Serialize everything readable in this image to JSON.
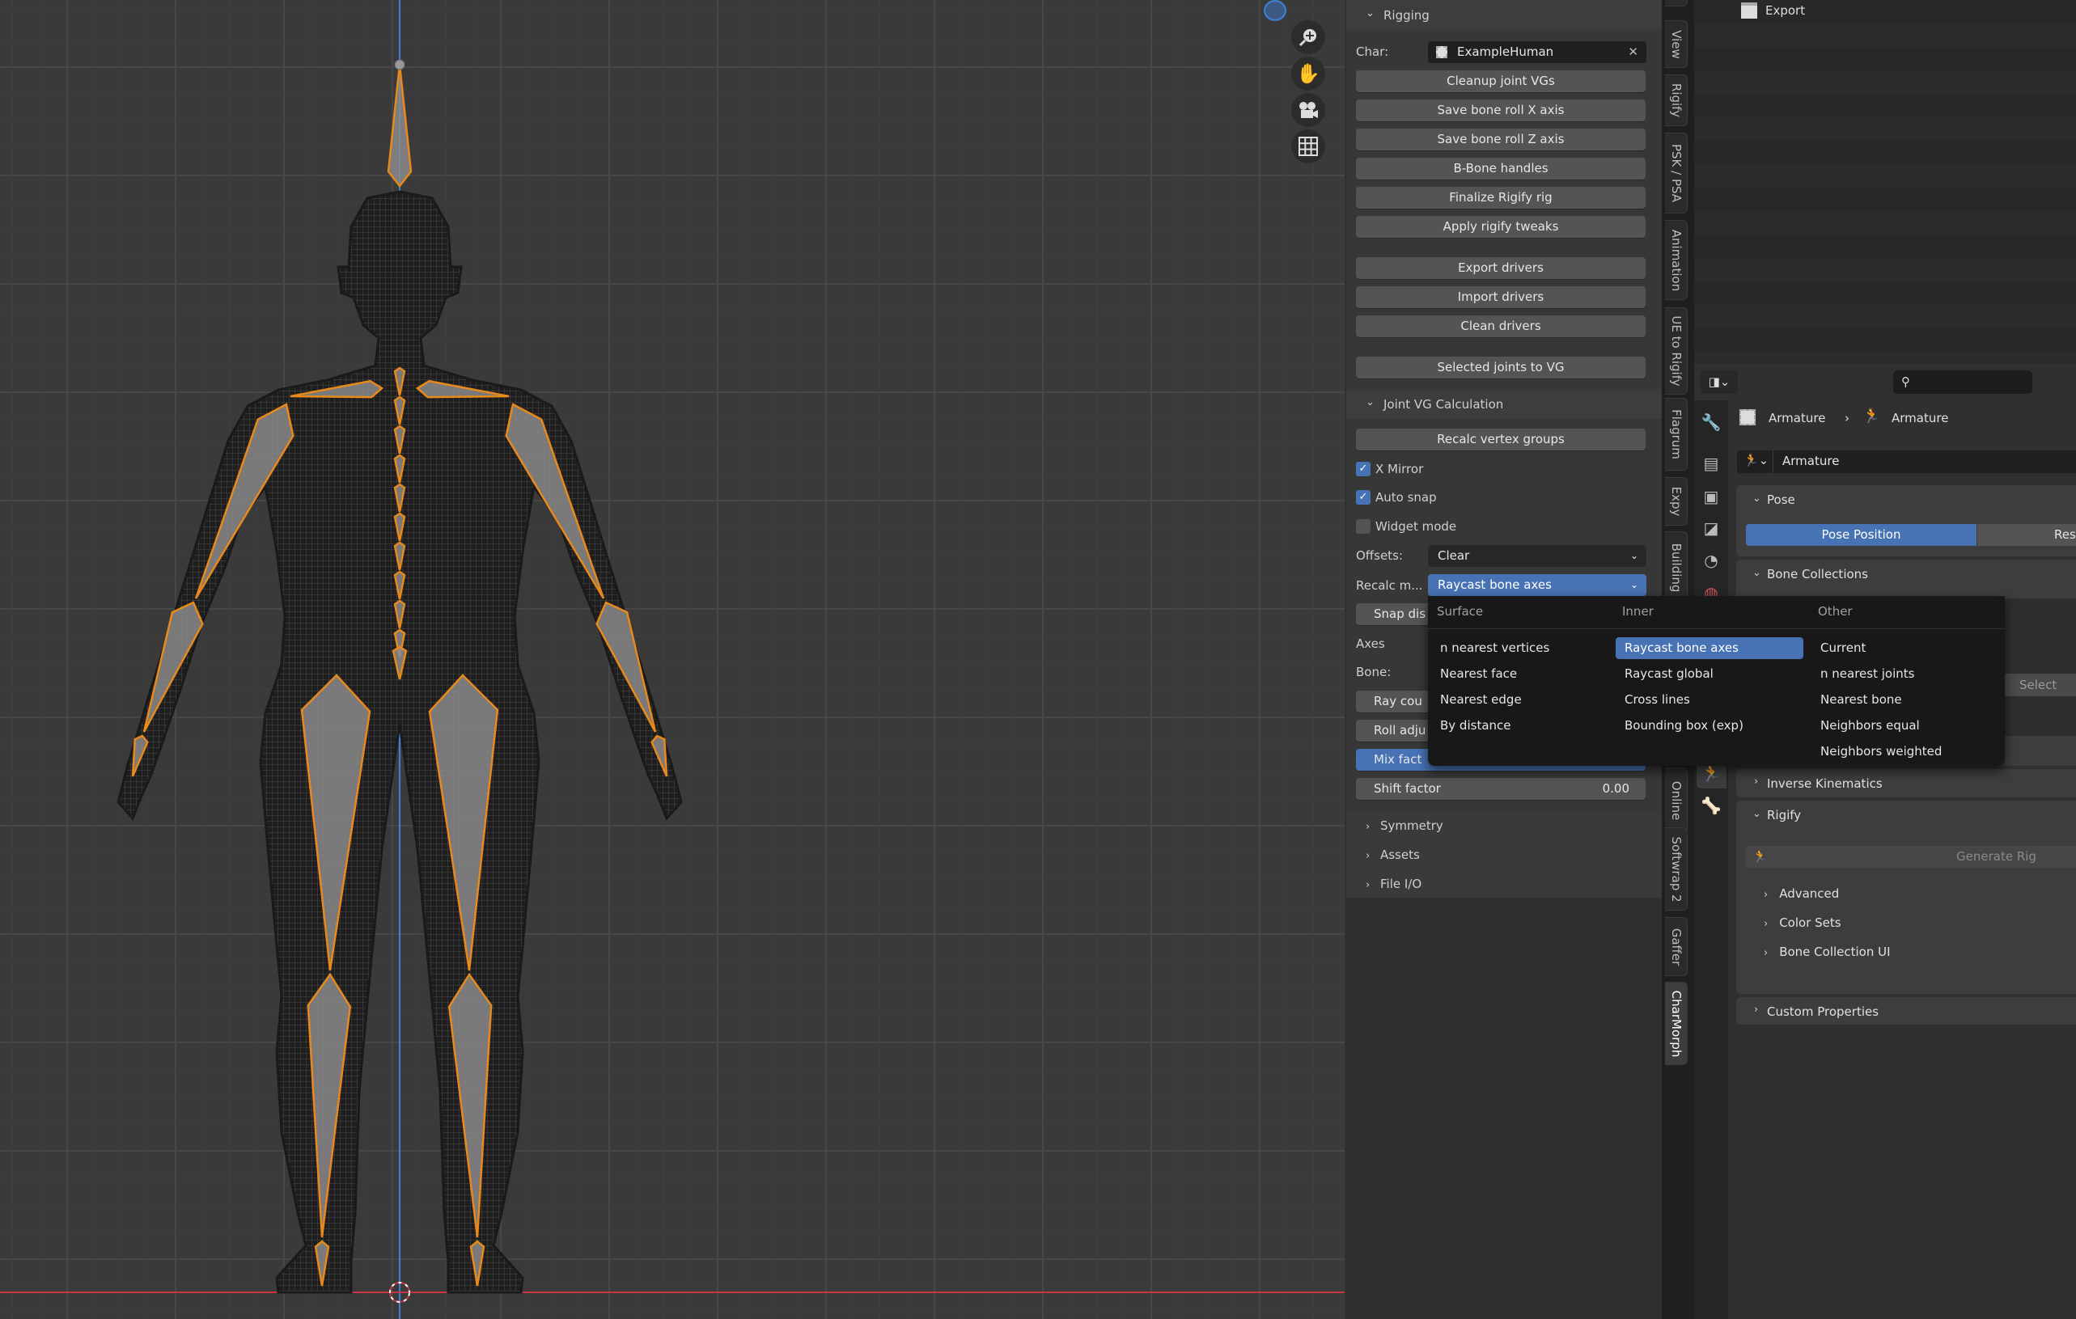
{
  "colors": {
    "accent": "#4772b3",
    "bone": "#e8891c",
    "axis_y": "#3f7fd6",
    "axis_x": "#c8343f",
    "active_icon": "#26c99a"
  },
  "viewport": {
    "gizmos": [
      "zoom-icon",
      "hand-pan-icon",
      "camera-icon",
      "grid-icon"
    ]
  },
  "npanel": {
    "rigging": {
      "title": "Rigging",
      "char_label": "Char:",
      "char_value": "ExampleHuman",
      "buttons": [
        "Cleanup joint VGs",
        "Save bone roll X axis",
        "Save bone roll Z axis",
        "B-Bone handles",
        "Finalize Rigify rig",
        "Apply rigify tweaks"
      ],
      "driver_buttons": [
        "Export drivers",
        "Import drivers",
        "Clean drivers"
      ],
      "selected_joints": "Selected joints to VG"
    },
    "joint_vg": {
      "title": "Joint VG Calculation",
      "recalc_button": "Recalc vertex groups",
      "checkboxes": [
        {
          "label": "X Mirror",
          "checked": true
        },
        {
          "label": "Auto snap",
          "checked": true
        },
        {
          "label": "Widget mode",
          "checked": false
        }
      ],
      "offsets_label": "Offsets:",
      "offsets_value": "Clear",
      "recalc_label": "Recalc m...",
      "recalc_value": "Raycast bone axes",
      "snap_button": "Snap dis",
      "axes_label": "Axes",
      "bone_label": "Bone:",
      "ray_button": "Ray cou",
      "roll_button": "Roll adju",
      "mix_button": "Mix fact",
      "shift_label": "Shift factor",
      "shift_value": "0.00"
    },
    "collapsed": [
      "Symmetry",
      "Assets",
      "File I/O"
    ]
  },
  "menu": {
    "headers": [
      "Surface",
      "Inner",
      "Other"
    ],
    "surface": [
      "n nearest vertices",
      "Nearest face",
      "Nearest edge",
      "By distance"
    ],
    "inner": [
      "Raycast bone axes",
      "Raycast global",
      "Cross lines",
      "Bounding box (exp)"
    ],
    "other": [
      "Current",
      "n nearest joints",
      "Nearest bone",
      "Neighbors equal",
      "Neighbors weighted"
    ],
    "selected": "Raycast bone axes"
  },
  "tabs": [
    "l",
    "View",
    "Rigify",
    "PSK / PSA",
    "Animation",
    "UE to Rigify",
    "Flagrum",
    "Expy",
    "Building",
    "Online",
    "Softwrap 2",
    "Gaffer",
    "CharMorph"
  ],
  "active_tab": "CharMorph",
  "outliner": {
    "items": [
      {
        "label": "Export",
        "icon": "collection-icon"
      }
    ]
  },
  "properties": {
    "search_placeholder": "",
    "breadcrumb": [
      "Armature",
      "Armature"
    ],
    "datablock": "Armature",
    "pose": {
      "title": "Pose",
      "pose_position": "Pose Position",
      "rest_position": "Rest"
    },
    "bone_collections": {
      "title": "Bone Collections",
      "select": "Select"
    },
    "ik": "Inverse Kinematics",
    "rigify": {
      "title": "Rigify",
      "generate": "Generate Rig",
      "subpanels": [
        "Advanced",
        "Color Sets",
        "Bone Collection UI"
      ]
    },
    "custom_properties": "Custom Properties"
  }
}
